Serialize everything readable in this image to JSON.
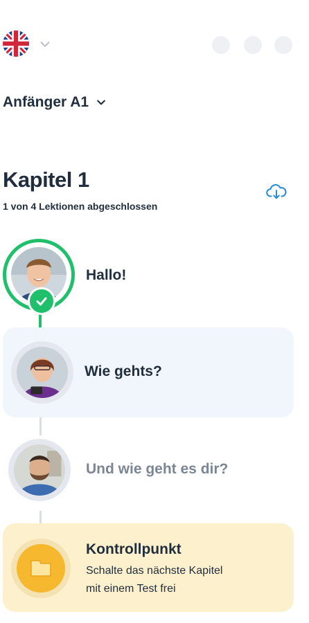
{
  "header": {
    "language_icon": "uk-flag-icon",
    "chevron_icon": "chevron-down-icon"
  },
  "level": {
    "label": "Anfänger A1"
  },
  "chapter": {
    "title": "Kapitel 1",
    "progress": "1 von 4 Lektionen abgeschlossen",
    "download_icon": "cloud-download-icon"
  },
  "lessons": [
    {
      "title": "Hallo!",
      "state": "completed"
    },
    {
      "title": "Wie gehts?",
      "state": "current"
    },
    {
      "title": "Und wie geht es dir?",
      "state": "locked"
    }
  ],
  "checkpoint": {
    "title": "Kontrollpunkt",
    "description_line1": "Schalte das nächste Kapitel",
    "description_line2": "mit einem Test frei",
    "icon": "flag-icon"
  },
  "colors": {
    "success_green": "#1fbf6c",
    "text_dark": "#1f2d3d",
    "muted_text": "#7b8694",
    "current_card_bg": "#f1f5fc",
    "checkpoint_bg": "#fdf0cc",
    "checkpoint_gold": "#f5b82e",
    "accent_blue": "#2a8bd8"
  }
}
